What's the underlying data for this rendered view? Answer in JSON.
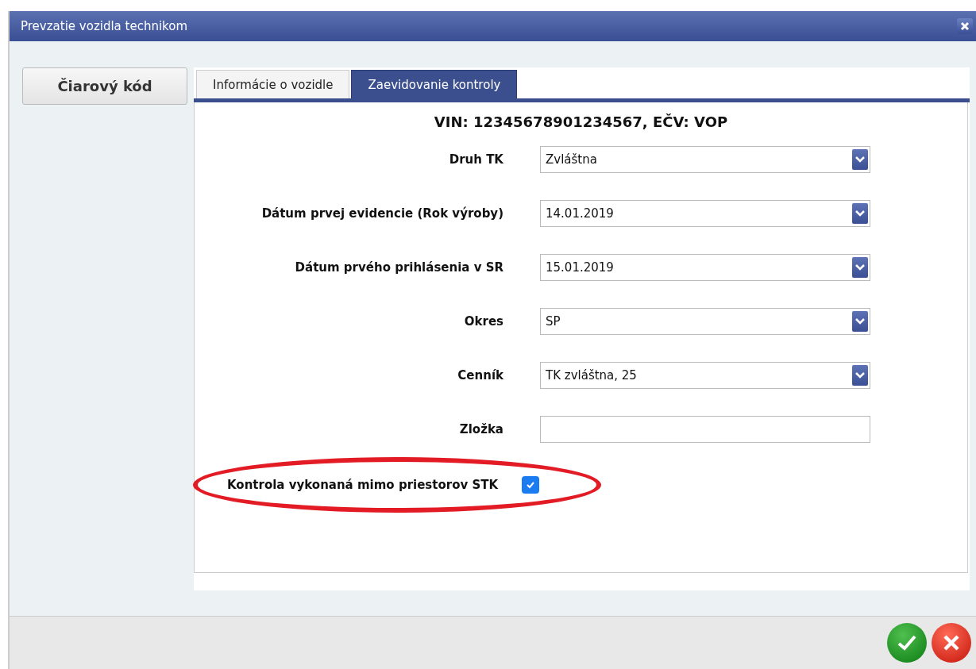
{
  "window": {
    "title": "Prevzatie vozidla technikom"
  },
  "barcode_button": "Čiarový kód",
  "tabs": [
    {
      "label": "Informácie o vozidle",
      "selected": false
    },
    {
      "label": "Zaevidovanie kontroly",
      "selected": true
    }
  ],
  "heading": "VIN: 12345678901234567, EČV: VOP",
  "fields": [
    {
      "label": "Druh TK",
      "kind": "select",
      "value": "Zvláštna"
    },
    {
      "label": "Dátum prvej evidencie (Rok výroby)",
      "kind": "select",
      "value": "14.01.2019"
    },
    {
      "label": "Dátum prvého prihlásenia v SR",
      "kind": "select",
      "value": "15.01.2019"
    },
    {
      "label": "Okres",
      "kind": "select",
      "value": "SP"
    },
    {
      "label": "Cenník",
      "kind": "select",
      "value": "TK zvláštna, 25"
    },
    {
      "label": "Zložka",
      "kind": "text"
    }
  ],
  "checkbox": {
    "label": "Kontrola vykonaná mimo priestorov STK",
    "checked": true,
    "highlighted": true
  }
}
